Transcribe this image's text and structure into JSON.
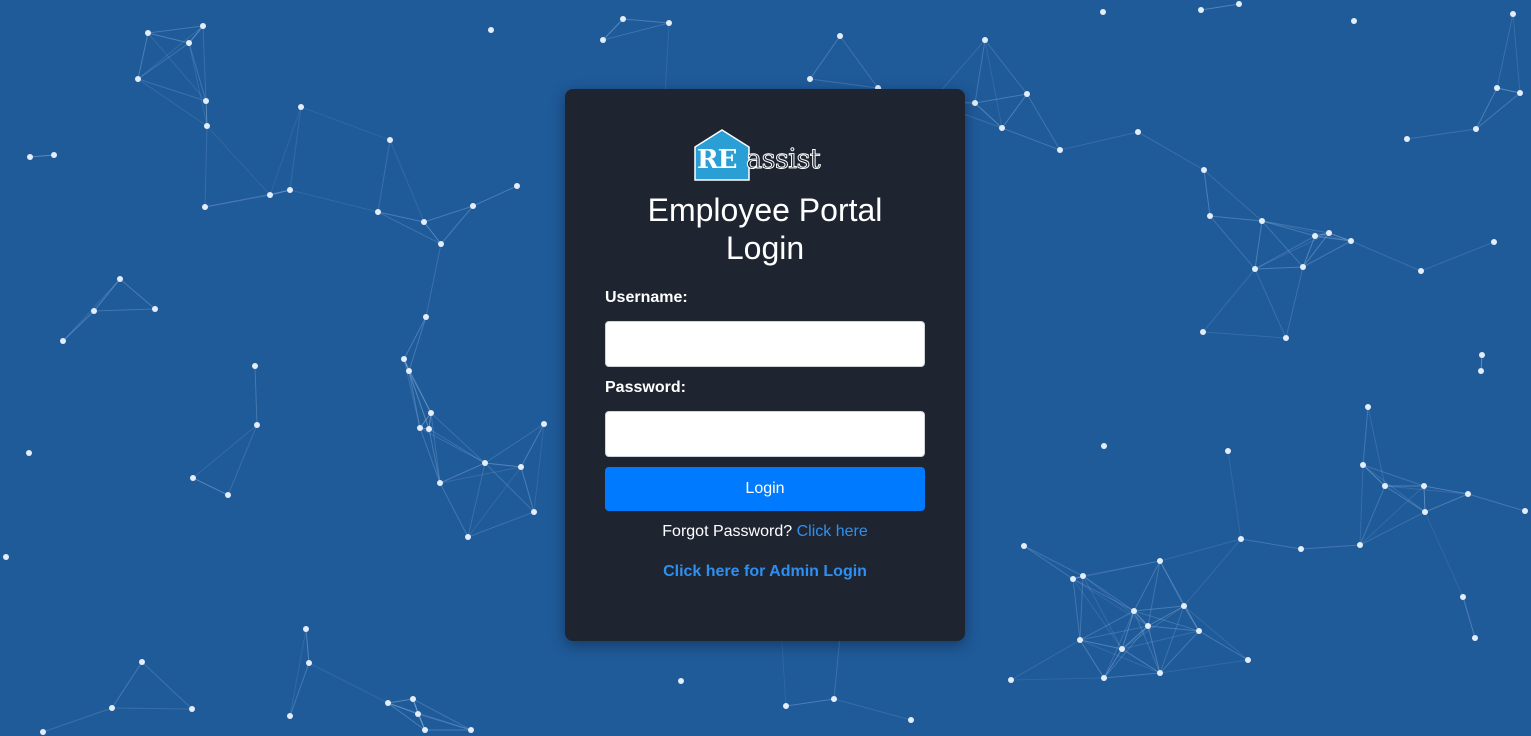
{
  "logo": {
    "re_text": "RE",
    "assist_text": "assist",
    "house_color": "#2a9fd6"
  },
  "title": {
    "line1": "Employee Portal",
    "line2": "Login"
  },
  "form": {
    "username_label": "Username:",
    "username_value": "",
    "password_label": "Password:",
    "password_value": "",
    "login_button_label": "Login"
  },
  "forgot": {
    "prompt": "Forgot Password?",
    "link_text": "Click here"
  },
  "admin_link_text": "Click here for Admin Login",
  "colors": {
    "background": "#1f5a99",
    "card": "#1e2530",
    "accent": "#007bff",
    "link": "#2f8ff0"
  }
}
